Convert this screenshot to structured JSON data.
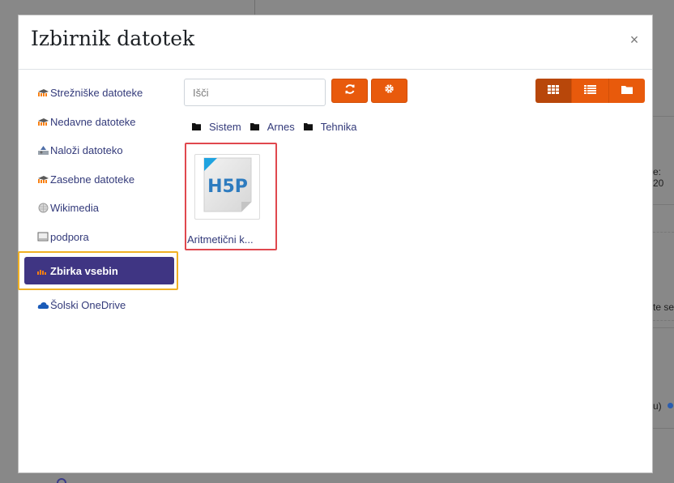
{
  "modal": {
    "title": "Izbirnik datotek",
    "close_glyph": "×"
  },
  "sidebar": {
    "items": [
      {
        "label": "Strežniške datoteke",
        "icon": "moodle-icon"
      },
      {
        "label": "Nedavne datoteke",
        "icon": "moodle-icon"
      },
      {
        "label": "Naloži datoteko",
        "icon": "upload-icon"
      },
      {
        "label": "Zasebne datoteke",
        "icon": "moodle-icon"
      },
      {
        "label": "Wikimedia",
        "icon": "wikimedia-icon"
      },
      {
        "label": "podpora",
        "icon": "drive-icon"
      },
      {
        "label": "Zbirka vsebin",
        "icon": "content-bank-icon",
        "active": true
      },
      {
        "label": "Šolski OneDrive",
        "icon": "onedrive-icon"
      }
    ]
  },
  "toolbar": {
    "search_placeholder": "Išči",
    "refresh_icon": "refresh-icon",
    "settings_icon": "gear-icon",
    "views": [
      "grid-view-icon",
      "list-view-icon",
      "folder-view-icon"
    ]
  },
  "breadcrumb": [
    "Sistem",
    "Arnes",
    "Tehnika"
  ],
  "files": [
    {
      "name": "Aritmetični k...",
      "icon": "h5p-icon"
    }
  ],
  "background": {
    "frag1": "e: 20",
    "frag2": "te se",
    "frag3": "u)"
  },
  "colors": {
    "accent": "#e85a0c",
    "active_item": "#3f3583",
    "link": "#333a7a",
    "highlight_sidebar": "#f0b024",
    "highlight_file": "#e0484e"
  }
}
